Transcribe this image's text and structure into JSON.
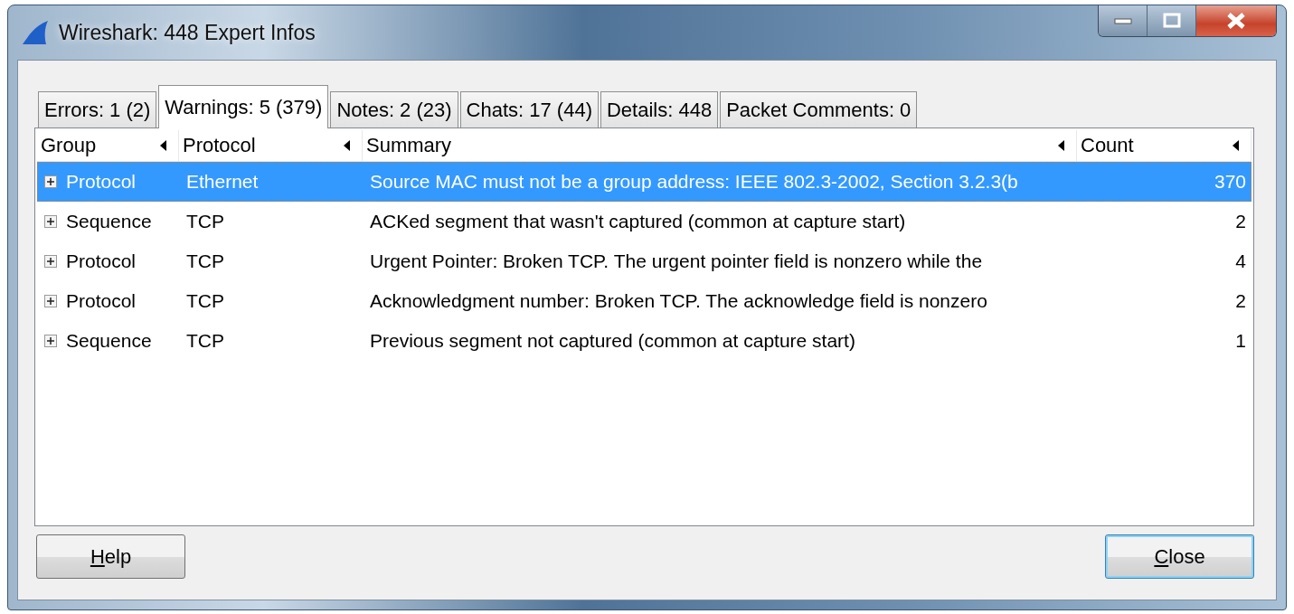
{
  "window": {
    "title": "Wireshark: 448 Expert Infos"
  },
  "tabs": [
    {
      "label": "Errors: 1 (2)",
      "selected": false
    },
    {
      "label": "Warnings: 5 (379)",
      "selected": true
    },
    {
      "label": "Notes: 2 (23)",
      "selected": false
    },
    {
      "label": "Chats: 17 (44)",
      "selected": false
    },
    {
      "label": "Details: 448",
      "selected": false
    },
    {
      "label": "Packet Comments: 0",
      "selected": false
    }
  ],
  "table": {
    "columns": [
      "Group",
      "Protocol",
      "Summary",
      "Count"
    ],
    "rows": [
      {
        "group": "Protocol",
        "protocol": "Ethernet",
        "summary": "Source MAC must not be a group address: IEEE 802.3-2002, Section 3.2.3(b",
        "count": "370",
        "selected": true,
        "expanded": false
      },
      {
        "group": "Sequence",
        "protocol": "TCP",
        "summary": "ACKed segment that wasn't captured (common at capture start)",
        "count": "2",
        "selected": false,
        "expanded": false
      },
      {
        "group": "Protocol",
        "protocol": "TCP",
        "summary": "Urgent Pointer: Broken TCP. The urgent pointer field is nonzero while the",
        "count": "4",
        "selected": false,
        "expanded": false
      },
      {
        "group": "Protocol",
        "protocol": "TCP",
        "summary": "Acknowledgment number: Broken TCP. The acknowledge field is nonzero",
        "count": "2",
        "selected": false,
        "expanded": false
      },
      {
        "group": "Sequence",
        "protocol": "TCP",
        "summary": "Previous segment not captured (common at capture start)",
        "count": "1",
        "selected": false,
        "expanded": false
      }
    ]
  },
  "buttons": [
    {
      "label": "Help",
      "accelerator_underlined": true,
      "default": false
    },
    {
      "label": "Close",
      "accelerator_underlined": true,
      "default": true
    }
  ]
}
